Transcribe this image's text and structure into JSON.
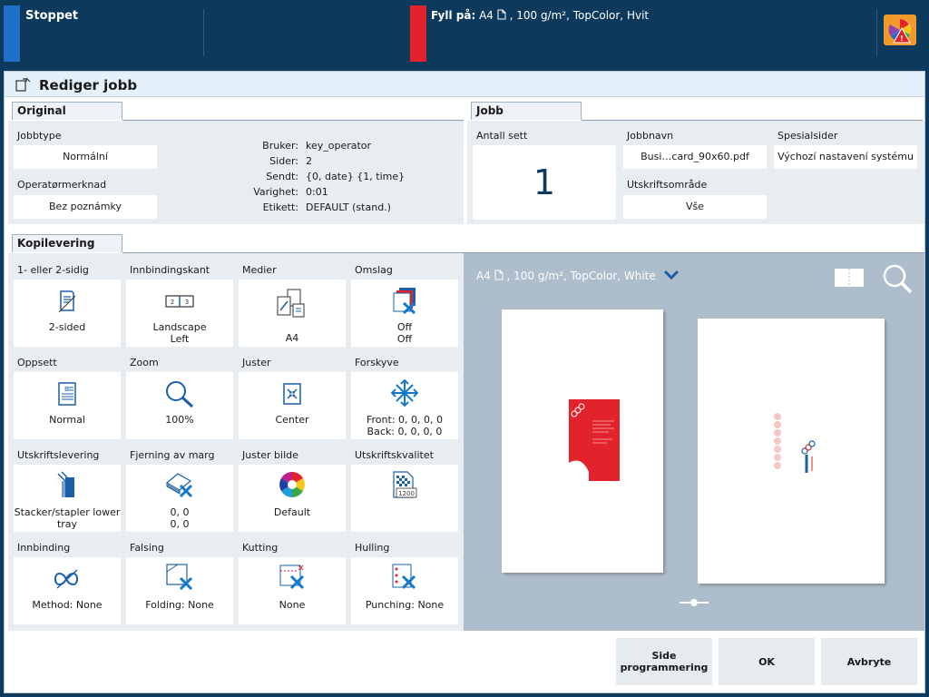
{
  "topbar": {
    "status": "Stoppet",
    "fill_label": "Fyll på:",
    "fill_size": "A4",
    "fill_details": ", 100 g/m², TopColor, Hvit"
  },
  "header": {
    "title": "Rediger jobb"
  },
  "original": {
    "tab": "Original",
    "jobtype_label": "Jobbtype",
    "jobtype_value": "Normální",
    "operator_note_label": "Operatørmerknad",
    "operator_note_value": "Bez poznámky",
    "info": [
      {
        "k": "Bruker:",
        "v": "key_operator"
      },
      {
        "k": "Sider:",
        "v": "2"
      },
      {
        "k": "Sendt:",
        "v": "{0, date} {1, time}"
      },
      {
        "k": "Varighet:",
        "v": "0:01"
      },
      {
        "k": "Etikett:",
        "v": "DEFAULT (stand.)"
      }
    ]
  },
  "jobb": {
    "tab": "Jobb",
    "sets_label": "Antall sett",
    "sets_value": "1",
    "jobname_label": "Jobbnavn",
    "jobname_value": "Busi…card_90x60.pdf",
    "special_label": "Spesialsider",
    "special_value": "Výchozí nastavení systému",
    "area_label": "Utskriftsområde",
    "area_value": "Vše"
  },
  "kopi": {
    "tab": "Kopilevering",
    "cells": [
      {
        "title": "1- eller 2-sidig",
        "l1": "2-sided",
        "l2": ""
      },
      {
        "title": "Innbindingskant",
        "l1": "Landscape",
        "l2": "Left"
      },
      {
        "title": "Medier",
        "l1": "A4",
        "l2": ""
      },
      {
        "title": "Omslag",
        "l1": "Off",
        "l2": "Off"
      },
      {
        "title": "Oppsett",
        "l1": "Normal",
        "l2": ""
      },
      {
        "title": "Zoom",
        "l1": "100%",
        "l2": ""
      },
      {
        "title": "Juster",
        "l1": "Center",
        "l2": ""
      },
      {
        "title": "Forskyve",
        "l1": "Front: 0, 0, 0, 0",
        "l2": "Back: 0, 0, 0, 0"
      },
      {
        "title": "Utskriftslevering",
        "l1": "Stacker/stapler lower",
        "l2": "tray"
      },
      {
        "title": "Fjerning av marg",
        "l1": "0, 0",
        "l2": "0, 0"
      },
      {
        "title": "Juster bilde",
        "l1": "Default",
        "l2": ""
      },
      {
        "title": "Utskriftskvalitet",
        "l1": "",
        "l2": ""
      },
      {
        "title": "Innbinding",
        "l1": "Method: None",
        "l2": ""
      },
      {
        "title": "Falsing",
        "l1": "Folding: None",
        "l2": ""
      },
      {
        "title": "Kutting",
        "l1": "None",
        "l2": ""
      },
      {
        "title": "Hulling",
        "l1": "Punching: None",
        "l2": ""
      }
    ],
    "quality_badge": "1200"
  },
  "preview": {
    "media_size": "A4",
    "media_details": ", 100 g/m², TopColor, White"
  },
  "buttons": {
    "side_prog_1": "Side",
    "side_prog_2": "programmering",
    "ok": "OK",
    "cancel": "Avbryte"
  },
  "colors": {
    "status_blue": "#1f6fc8",
    "alert_red": "#e3232b",
    "icon_blue": "#1a5fa8",
    "x_blue": "#1479c9"
  }
}
